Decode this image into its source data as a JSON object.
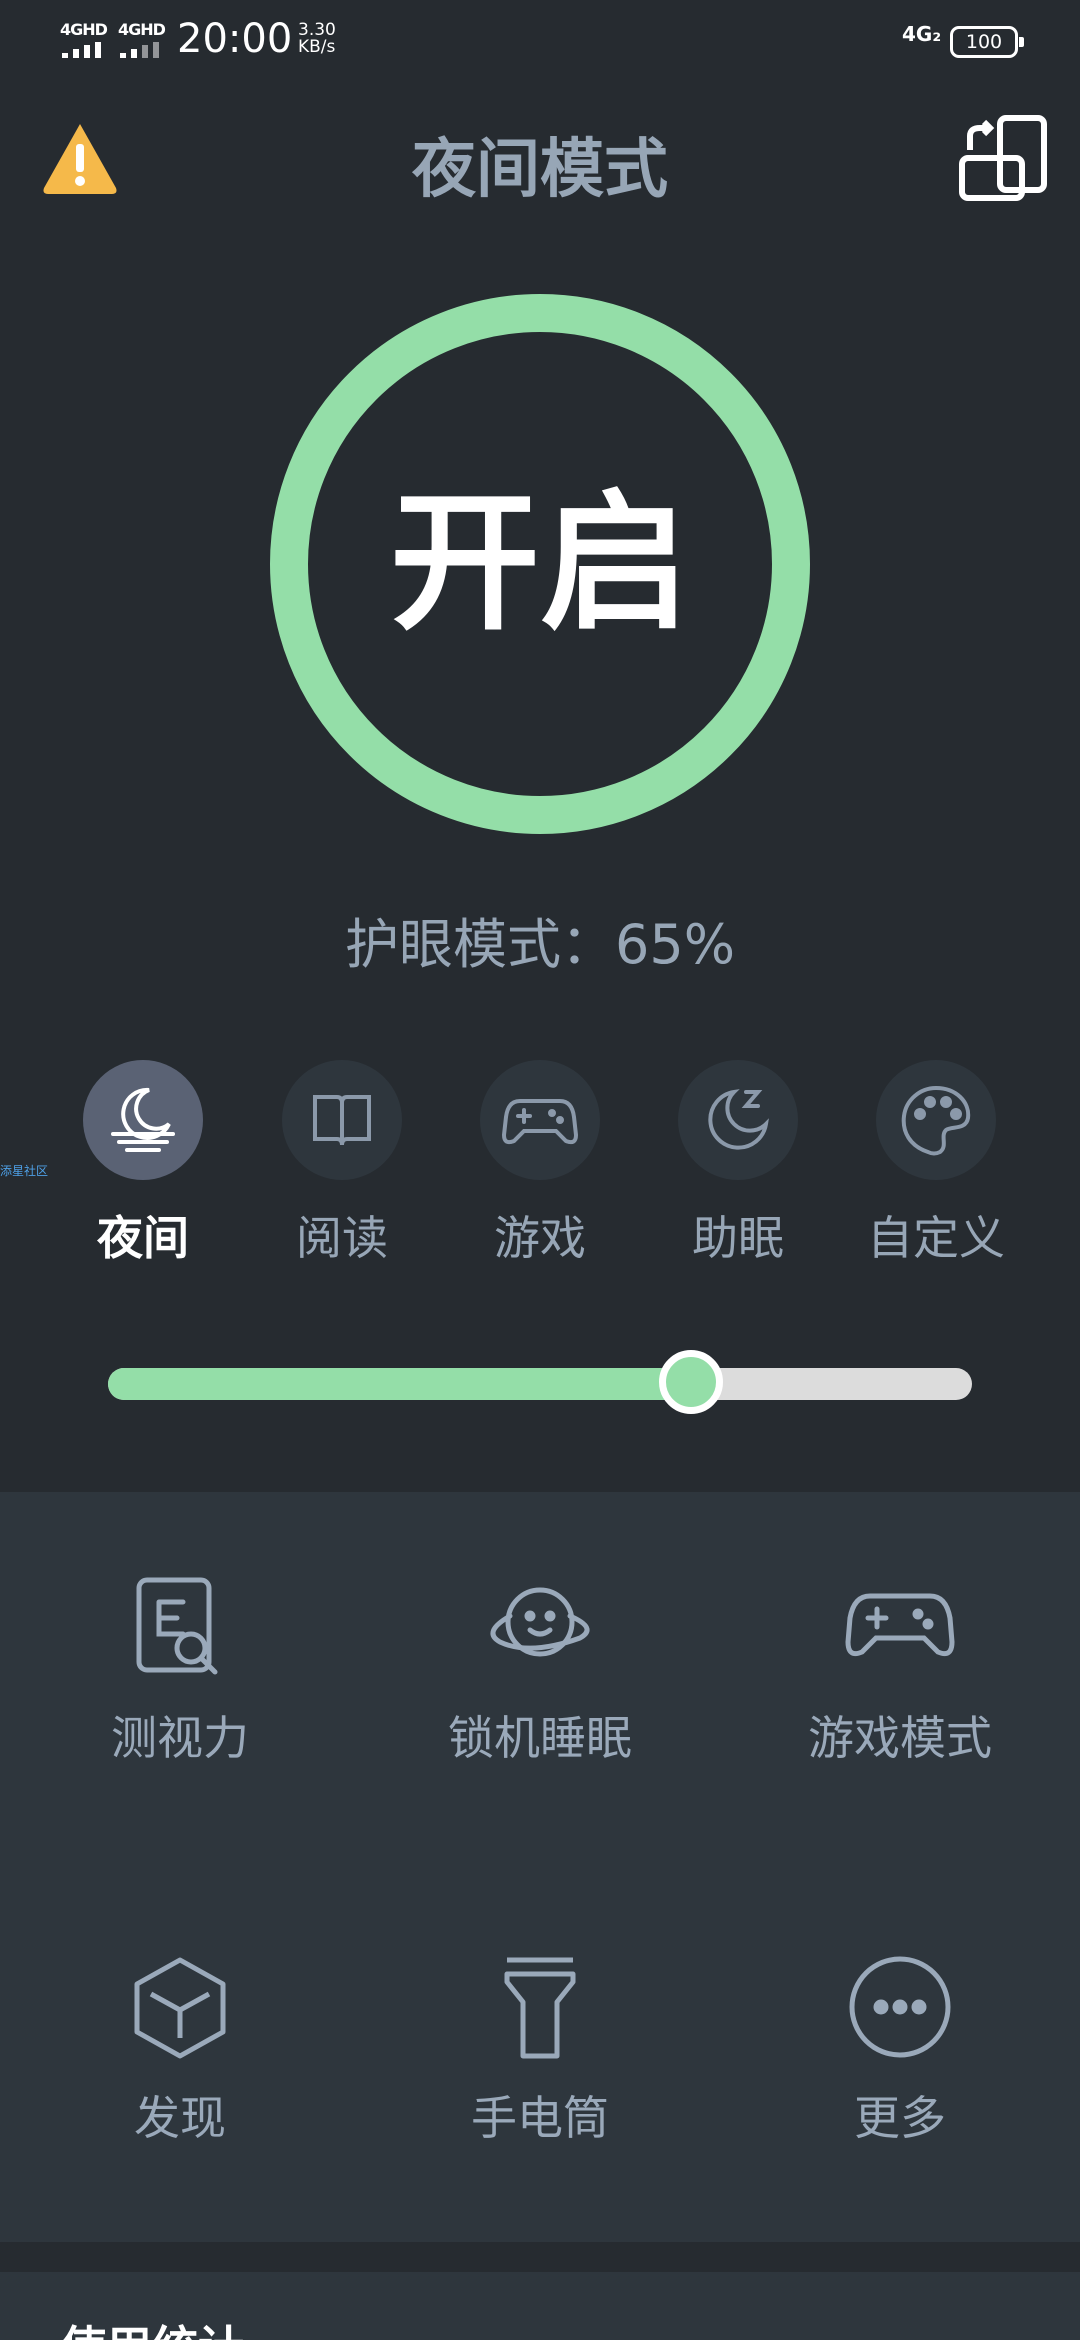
{
  "status_bar": {
    "sim1": "4GHD",
    "sim2": "4GHD",
    "time": "20:00",
    "speed_value": "3.30",
    "speed_unit": "KB/s",
    "network_right": "4G₂",
    "battery": "100"
  },
  "header": {
    "title": "夜间模式",
    "left_icon": "warning-icon",
    "right_icon": "rotate-screen-icon"
  },
  "power": {
    "label": "开启",
    "ring_color": "#94dea8"
  },
  "eye_mode": {
    "text": "护眼模式：65%",
    "level": 0.65
  },
  "modes": [
    {
      "label": "夜间",
      "icon": "moon-sea-icon",
      "active": true
    },
    {
      "label": "阅读",
      "icon": "book-icon",
      "active": false
    },
    {
      "label": "游戏",
      "icon": "gamepad-icon",
      "active": false
    },
    {
      "label": "助眠",
      "icon": "sleep-moon-icon",
      "active": false
    },
    {
      "label": "自定义",
      "icon": "palette-icon",
      "active": false
    }
  ],
  "watermark": "添星社区",
  "slider": {
    "value": 0.675,
    "fill_color": "#94dea8",
    "track_color": "#dcdcdc"
  },
  "tools": [
    {
      "label": "测视力",
      "icon": "eye-test-icon"
    },
    {
      "label": "锁机睡眠",
      "icon": "planet-face-icon"
    },
    {
      "label": "游戏模式",
      "icon": "gamepad-icon"
    },
    {
      "label": "发现",
      "icon": "cube-icon"
    },
    {
      "label": "手电筒",
      "icon": "flashlight-icon"
    },
    {
      "label": "更多",
      "icon": "more-icon"
    }
  ],
  "stats": {
    "title": "使用统计"
  },
  "colors": {
    "background": "#262b30",
    "panel": "#2e363d",
    "accent": "#94dea8",
    "text": "#97a6b6",
    "warning": "#f5b94a"
  }
}
